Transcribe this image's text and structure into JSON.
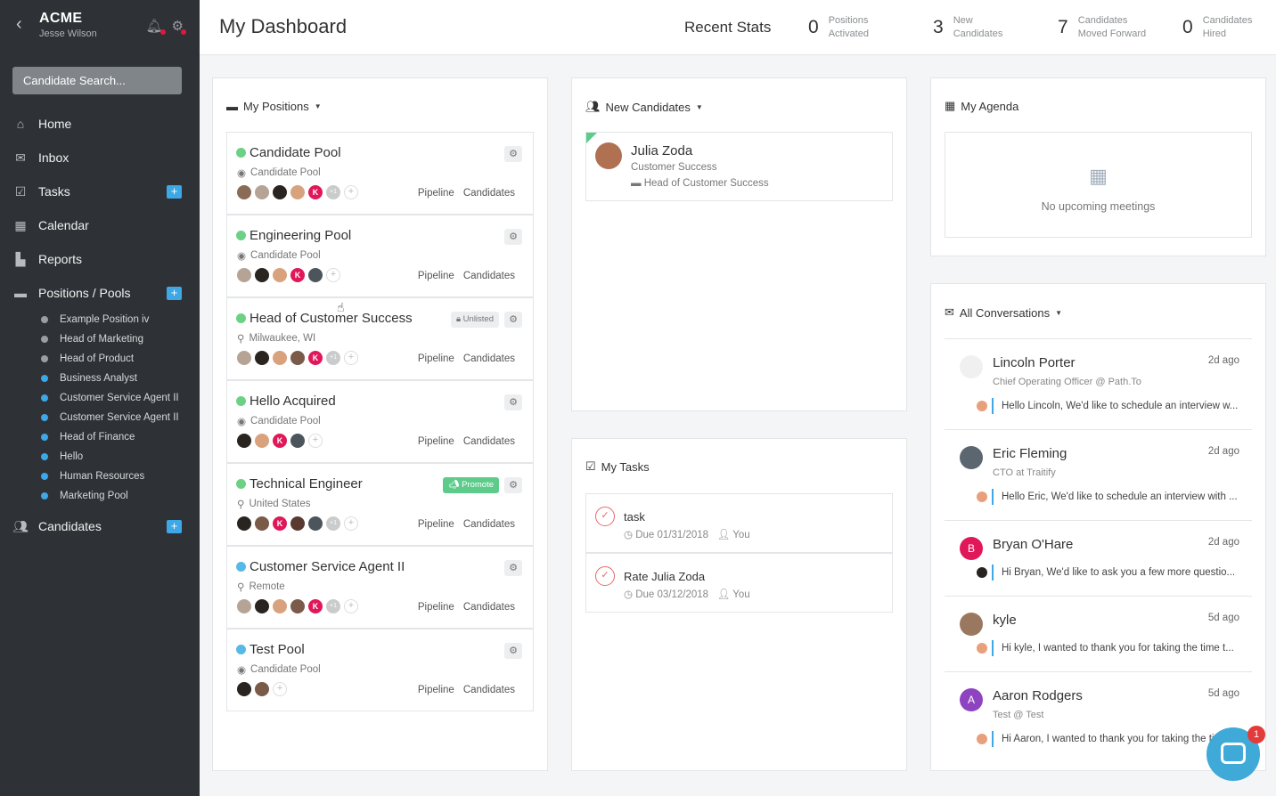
{
  "sidebar": {
    "company": "ACME",
    "user": "Jesse Wilson",
    "search_placeholder": "Candidate Search...",
    "nav": [
      {
        "label": "Home",
        "icon": "home-icon"
      },
      {
        "label": "Inbox",
        "icon": "envelope-icon"
      },
      {
        "label": "Tasks",
        "icon": "checkbox-icon"
      },
      {
        "label": "Calendar",
        "icon": "calendar-icon"
      },
      {
        "label": "Reports",
        "icon": "bar-chart-icon"
      },
      {
        "label": "Positions / Pools",
        "icon": "briefcase-icon"
      }
    ],
    "positions": [
      "Example Position iv",
      "Head of Marketing",
      "Head of Product",
      "Business Analyst",
      "Customer Service Agent II",
      "Customer Service Agent II",
      "Head of Finance",
      "Hello",
      "Human Resources",
      "Marketing Pool"
    ],
    "candidates_label": "Candidates"
  },
  "header": {
    "title": "My Dashboard",
    "recent_stats_label": "Recent Stats",
    "stats": [
      {
        "value": "0",
        "line1": "Positions",
        "line2": "Activated"
      },
      {
        "value": "3",
        "line1": "New",
        "line2": "Candidates"
      },
      {
        "value": "7",
        "line1": "Candidates",
        "line2": "Moved Forward"
      },
      {
        "value": "0",
        "line1": "Candidates",
        "line2": "Hired"
      }
    ]
  },
  "my_positions": {
    "title": "My Positions",
    "pipeline_label": "Pipeline",
    "candidates_label": "Candidates",
    "items": [
      {
        "title": "Candidate Pool",
        "subtitle": "Candidate Pool",
        "more": "+1"
      },
      {
        "title": "Engineering Pool",
        "subtitle": "Candidate Pool"
      },
      {
        "title": "Head of Customer Success",
        "subtitle": "Milwaukee, WI",
        "badge": "Unlisted",
        "more": "+1"
      },
      {
        "title": "Hello Acquired",
        "subtitle": "Candidate Pool"
      },
      {
        "title": "Technical Engineer",
        "subtitle": "United States",
        "badge": "Promote",
        "more": "+1"
      },
      {
        "title": "Customer Service Agent II",
        "subtitle": "Remote",
        "more": "+1"
      },
      {
        "title": "Test Pool",
        "subtitle": "Candidate Pool"
      }
    ]
  },
  "new_candidates": {
    "title": "New Candidates",
    "items": [
      {
        "name": "Julia Zoda",
        "role": "Customer Success",
        "position": "Head of Customer Success"
      }
    ]
  },
  "my_tasks": {
    "title": "My Tasks",
    "items": [
      {
        "title": "task",
        "due": "Due 01/31/2018",
        "owner": "You"
      },
      {
        "title": "Rate Julia Zoda",
        "due": "Due 03/12/2018",
        "owner": "You"
      }
    ]
  },
  "agenda": {
    "title": "My Agenda",
    "empty": "No upcoming meetings"
  },
  "conversations": {
    "title": "All Conversations",
    "items": [
      {
        "name": "Lincoln Porter",
        "time": "2d ago",
        "sub": "Chief Operating Officer @ Path.To",
        "msg": "Hello Lincoln, We'd like to schedule an interview w..."
      },
      {
        "name": "Eric Fleming",
        "time": "2d ago",
        "sub": "CTO at Traitify",
        "msg": "Hello Eric, We'd like to schedule an interview with ..."
      },
      {
        "name": "Bryan O'Hare",
        "time": "2d ago",
        "initial": "B",
        "msg": "Hi Bryan,  We'd like to ask you a few more questio..."
      },
      {
        "name": "kyle",
        "time": "5d ago",
        "msg": "Hi kyle, I wanted to thank you for taking the time t..."
      },
      {
        "name": "Aaron Rodgers",
        "time": "5d ago",
        "initial": "A",
        "sub": "Test @ Test",
        "msg": "Hi Aaron, I wanted to thank you for taking the ti"
      }
    ]
  },
  "chat_badge": "1"
}
